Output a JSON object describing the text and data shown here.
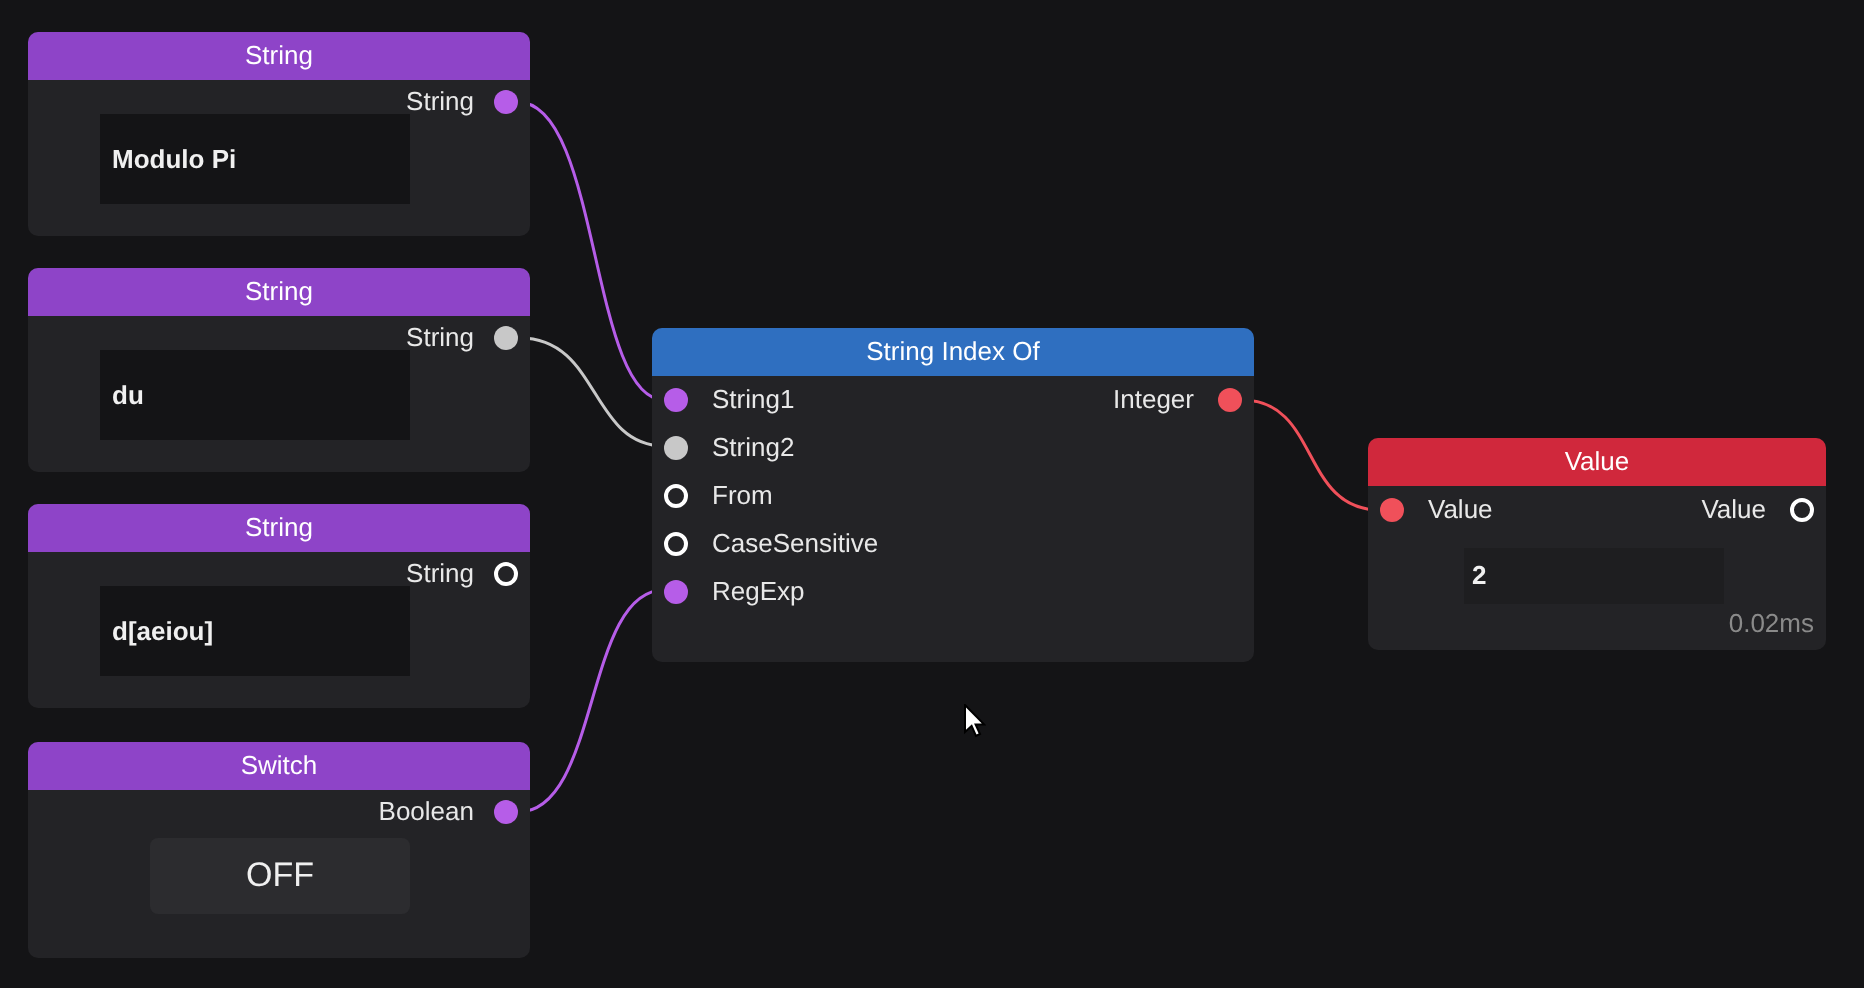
{
  "nodes": [
    {
      "kind": "string",
      "title": "String",
      "color": "#8e44c8",
      "outputs": [
        {
          "label": "String",
          "color": "#b65de8",
          "connected": true
        }
      ],
      "value": "Modulo Pi"
    },
    {
      "kind": "string",
      "title": "String",
      "color": "#8e44c8",
      "outputs": [
        {
          "label": "String",
          "color": "#c8c8c8",
          "connected": true
        }
      ],
      "value": "du"
    },
    {
      "kind": "string",
      "title": "String",
      "color": "#8e44c8",
      "outputs": [
        {
          "label": "String",
          "color": "#ffffff",
          "connected": false
        }
      ],
      "value": "d[aeiou]"
    },
    {
      "kind": "switch",
      "title": "Switch",
      "color": "#8e44c8",
      "outputs": [
        {
          "label": "Boolean",
          "color": "#b65de8",
          "connected": true
        }
      ],
      "value": "OFF"
    },
    {
      "kind": "function",
      "title": "String Index Of",
      "color": "#2f6fc0",
      "inputs": [
        {
          "label": "String1",
          "color": "#b65de8",
          "connected": true
        },
        {
          "label": "String2",
          "color": "#c8c8c8",
          "connected": true
        },
        {
          "label": "From",
          "color": "#ffffff",
          "connected": false
        },
        {
          "label": "CaseSensitive",
          "color": "#ffffff",
          "connected": false
        },
        {
          "label": "RegExp",
          "color": "#b65de8",
          "connected": true
        }
      ],
      "outputs": [
        {
          "label": "Integer",
          "color": "#f0505a",
          "connected": true
        }
      ]
    },
    {
      "kind": "value",
      "title": "Value",
      "color": "#d0283c",
      "inputs": [
        {
          "label": "Value",
          "color": "#f0505a",
          "connected": true
        }
      ],
      "outputs": [
        {
          "label": "Value",
          "color": "#ffffff",
          "connected": false
        }
      ],
      "value": "2",
      "timing": "0.02ms"
    }
  ]
}
